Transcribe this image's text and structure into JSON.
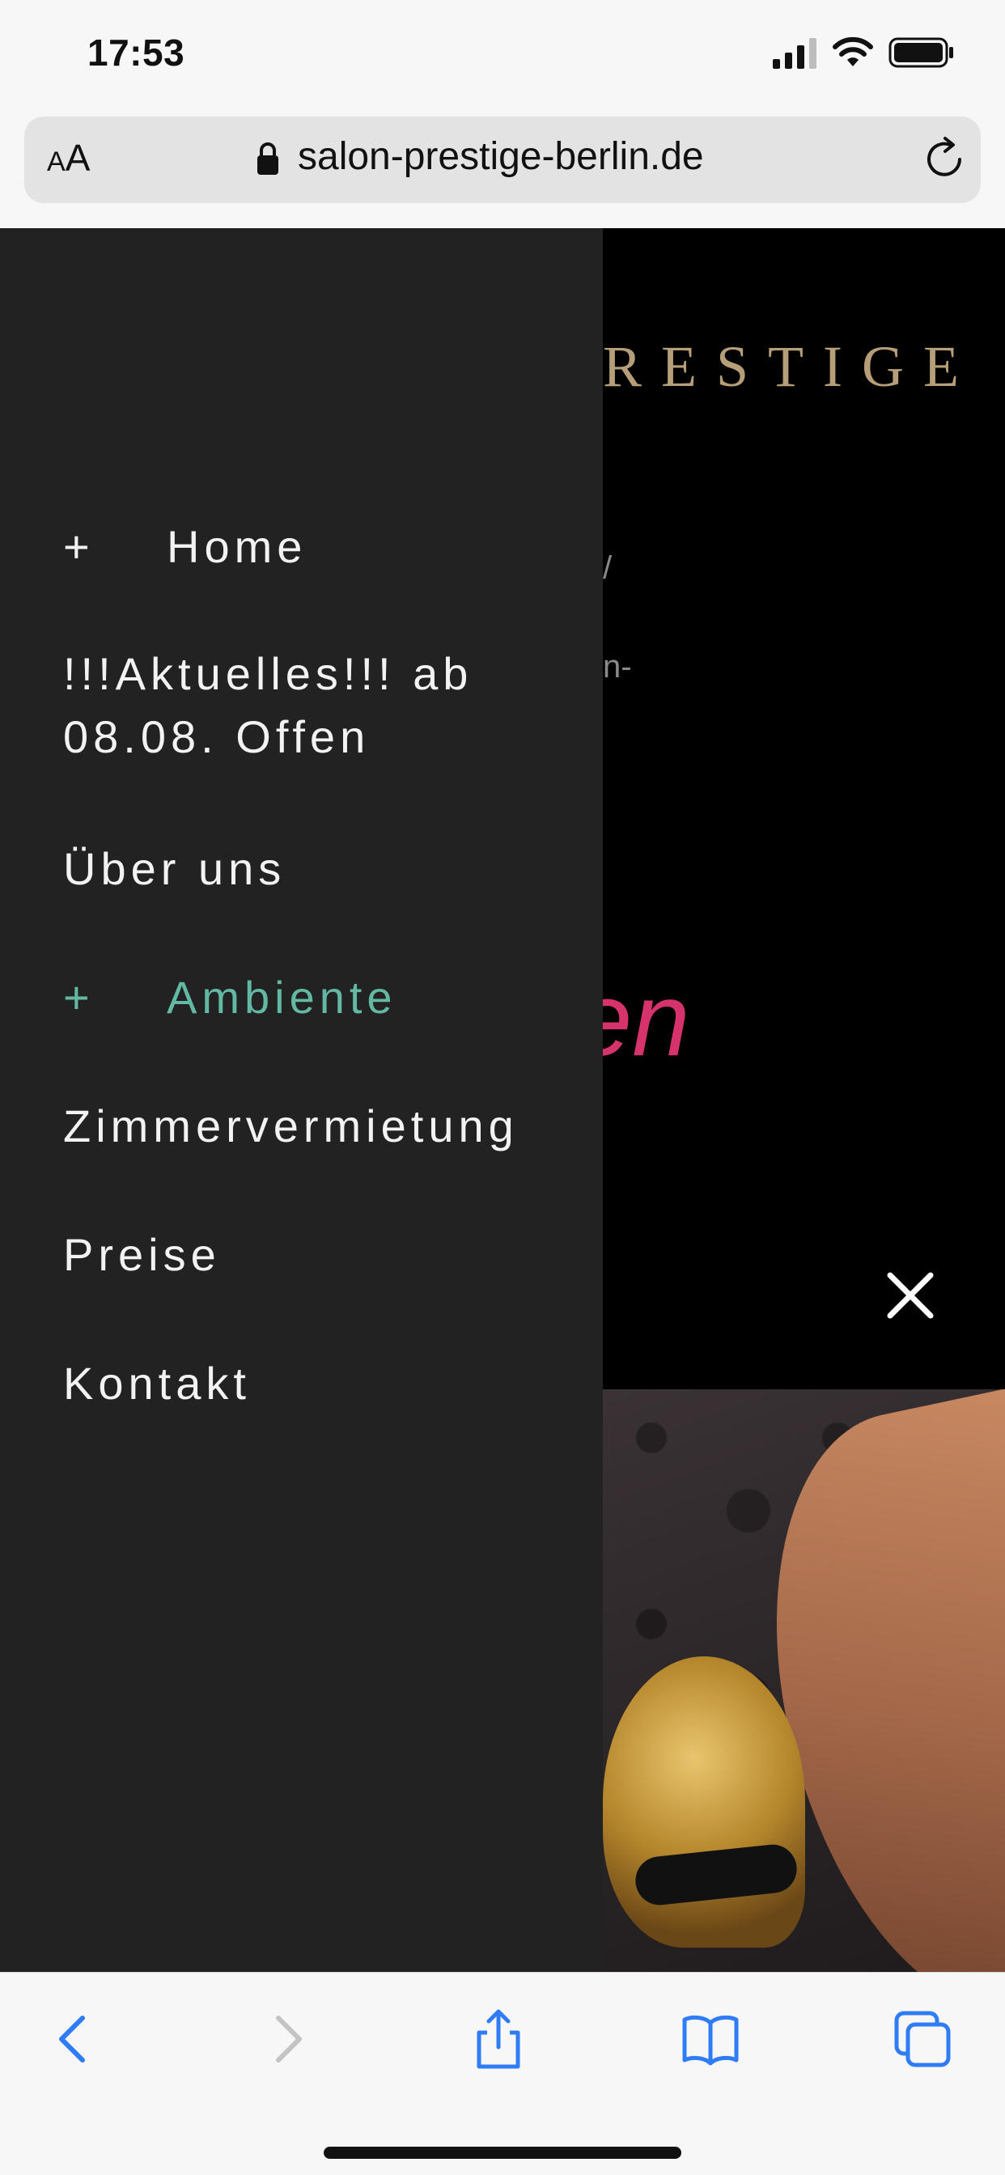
{
  "status_bar": {
    "time": "17:53"
  },
  "browser": {
    "text_size_button_small": "A",
    "text_size_button_large": "A",
    "url": "salon-prestige-berlin.de"
  },
  "background_page": {
    "logo_text": "RESTIGE",
    "fragment_1": "/",
    "fragment_2": "n-",
    "pink_fragment": "en"
  },
  "menu": {
    "items": [
      {
        "label": "Home",
        "expandable": true,
        "icon": "plus-icon",
        "active": false
      },
      {
        "label": "!!!Aktuelles!!! ab",
        "label_line2": "08.08. Offen",
        "expandable": false,
        "active": false
      },
      {
        "label": "Über uns",
        "expandable": false,
        "active": false
      },
      {
        "label": "Ambiente",
        "expandable": true,
        "icon": "plus-icon",
        "active": true
      },
      {
        "label": "Zimmervermietung",
        "expandable": false,
        "active": false
      },
      {
        "label": "Preise",
        "expandable": false,
        "active": false
      },
      {
        "label": "Kontakt",
        "expandable": false,
        "active": false
      }
    ],
    "plus_symbol": "+",
    "active_color": "#62b8a2",
    "background_color": "#222223"
  },
  "toolbar": {
    "icons": [
      "back-icon",
      "forward-icon",
      "share-icon",
      "bookmarks-icon",
      "tabs-icon"
    ],
    "accent_color": "#2f7cf6"
  }
}
